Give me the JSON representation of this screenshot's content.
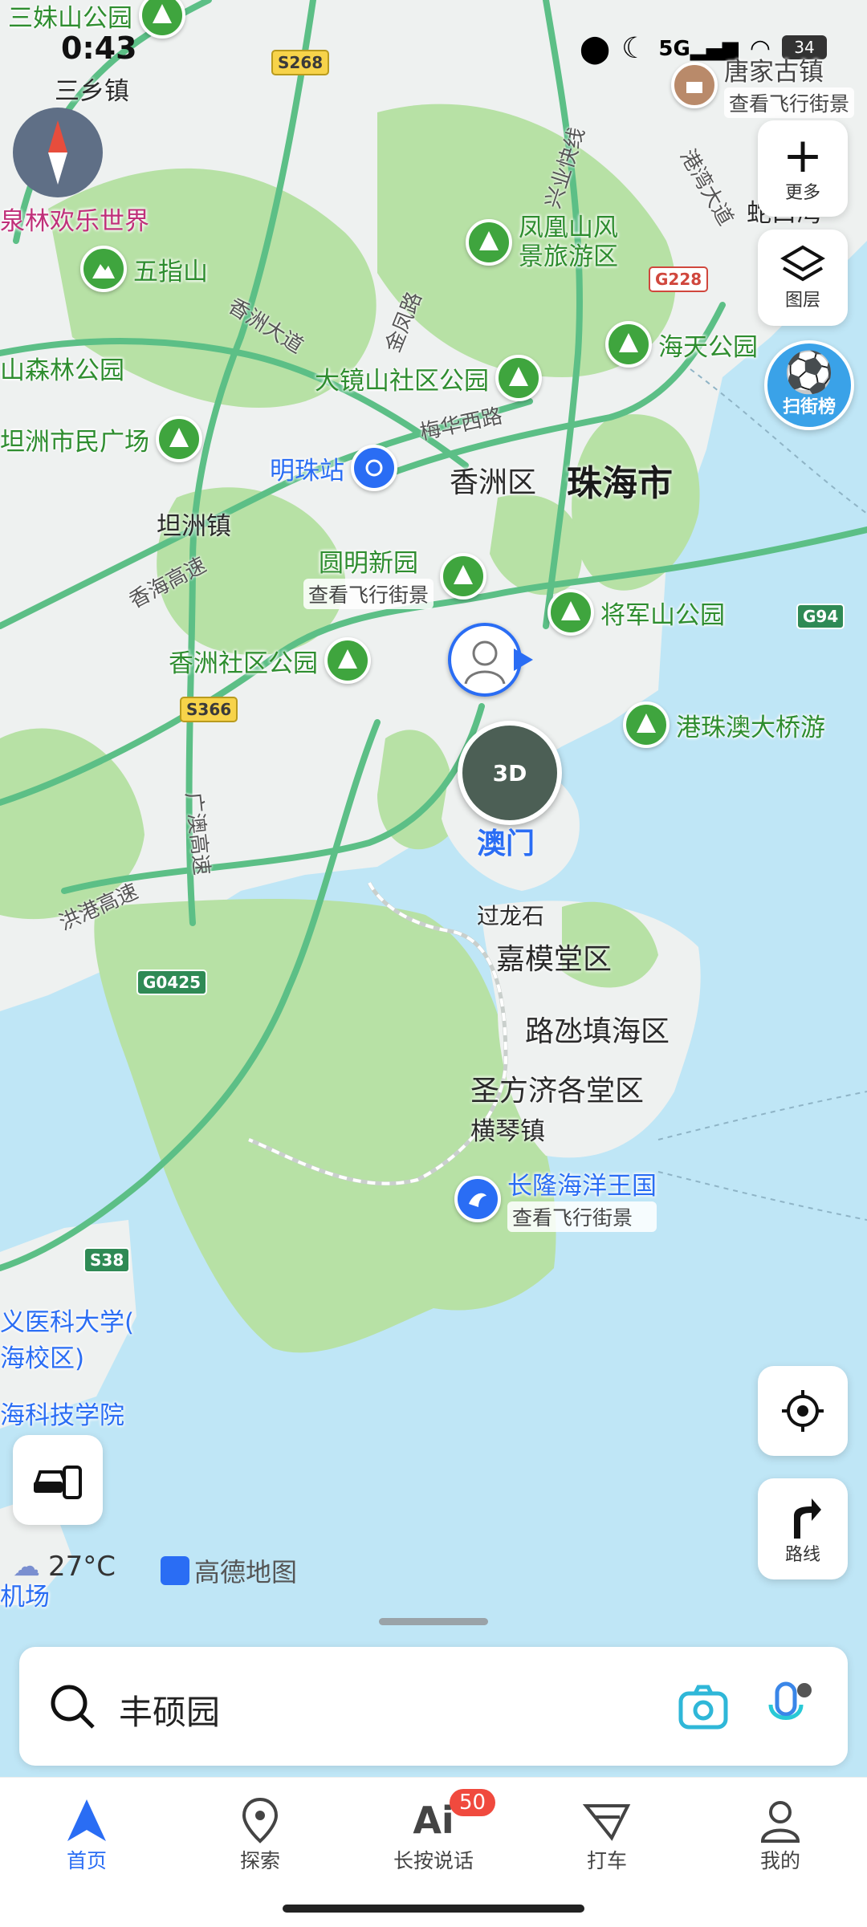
{
  "status_bar": {
    "time": "0:43",
    "battery": "34"
  },
  "map": {
    "weather": {
      "temperature": "27°C"
    },
    "brand": "高德地图",
    "city": "珠海市",
    "districts": [
      "香洲区",
      "嘉模堂区",
      "路氹填海区",
      "圣方济各堂区"
    ],
    "towns": [
      "三乡镇",
      "坦洲镇",
      "过龙石",
      "横琴镇",
      "蛇口湾"
    ],
    "roads": [
      "兴业快线",
      "香洲大道",
      "金凤路",
      "港湾大道",
      "梅华西路",
      "香海高速",
      "广澳高速",
      "洪港高速"
    ],
    "shields": [
      "S268",
      "G228",
      "G94",
      "S366",
      "G0425",
      "S38"
    ],
    "pois": [
      {
        "name": "三妹山公园"
      },
      {
        "name": "唐家古镇",
        "sub": "查看飞行街景"
      },
      {
        "name": "泉林欢乐世界"
      },
      {
        "name": "凤凰山风景旅游区"
      },
      {
        "name": "五指山"
      },
      {
        "name": "海天公园"
      },
      {
        "name": "山森林公园"
      },
      {
        "name": "大镜山社区公园"
      },
      {
        "name": "坦洲市民广场"
      },
      {
        "name": "明珠站"
      },
      {
        "name": "圆明新园",
        "sub": "查看飞行街景"
      },
      {
        "name": "将军山公园"
      },
      {
        "name": "香洲社区公园"
      },
      {
        "name": "港珠澳大桥游"
      },
      {
        "name": "澳门",
        "badge": "3D"
      },
      {
        "name": "长隆海洋王国",
        "sub": "查看飞行街景"
      },
      {
        "name": "义医科大学(",
        "name2": "海校区)"
      },
      {
        "name": "海科技学院"
      },
      {
        "name": "机场"
      }
    ]
  },
  "controls": {
    "more_label": "更多",
    "layers_label": "图层",
    "street_rank_label": "扫街榜",
    "route_label": "路线"
  },
  "search": {
    "value": "丰硕园"
  },
  "tabs": [
    {
      "label": "首页",
      "active": true
    },
    {
      "label": "探索"
    },
    {
      "label": "长按说话",
      "badge": "50"
    },
    {
      "label": "打车"
    },
    {
      "label": "我的"
    }
  ],
  "colors": {
    "accent": "#2a6df4",
    "park": "#3fa53e",
    "water": "#bfe6f6",
    "land": "#f0f2f1",
    "green_land": "#b9e3a8"
  }
}
